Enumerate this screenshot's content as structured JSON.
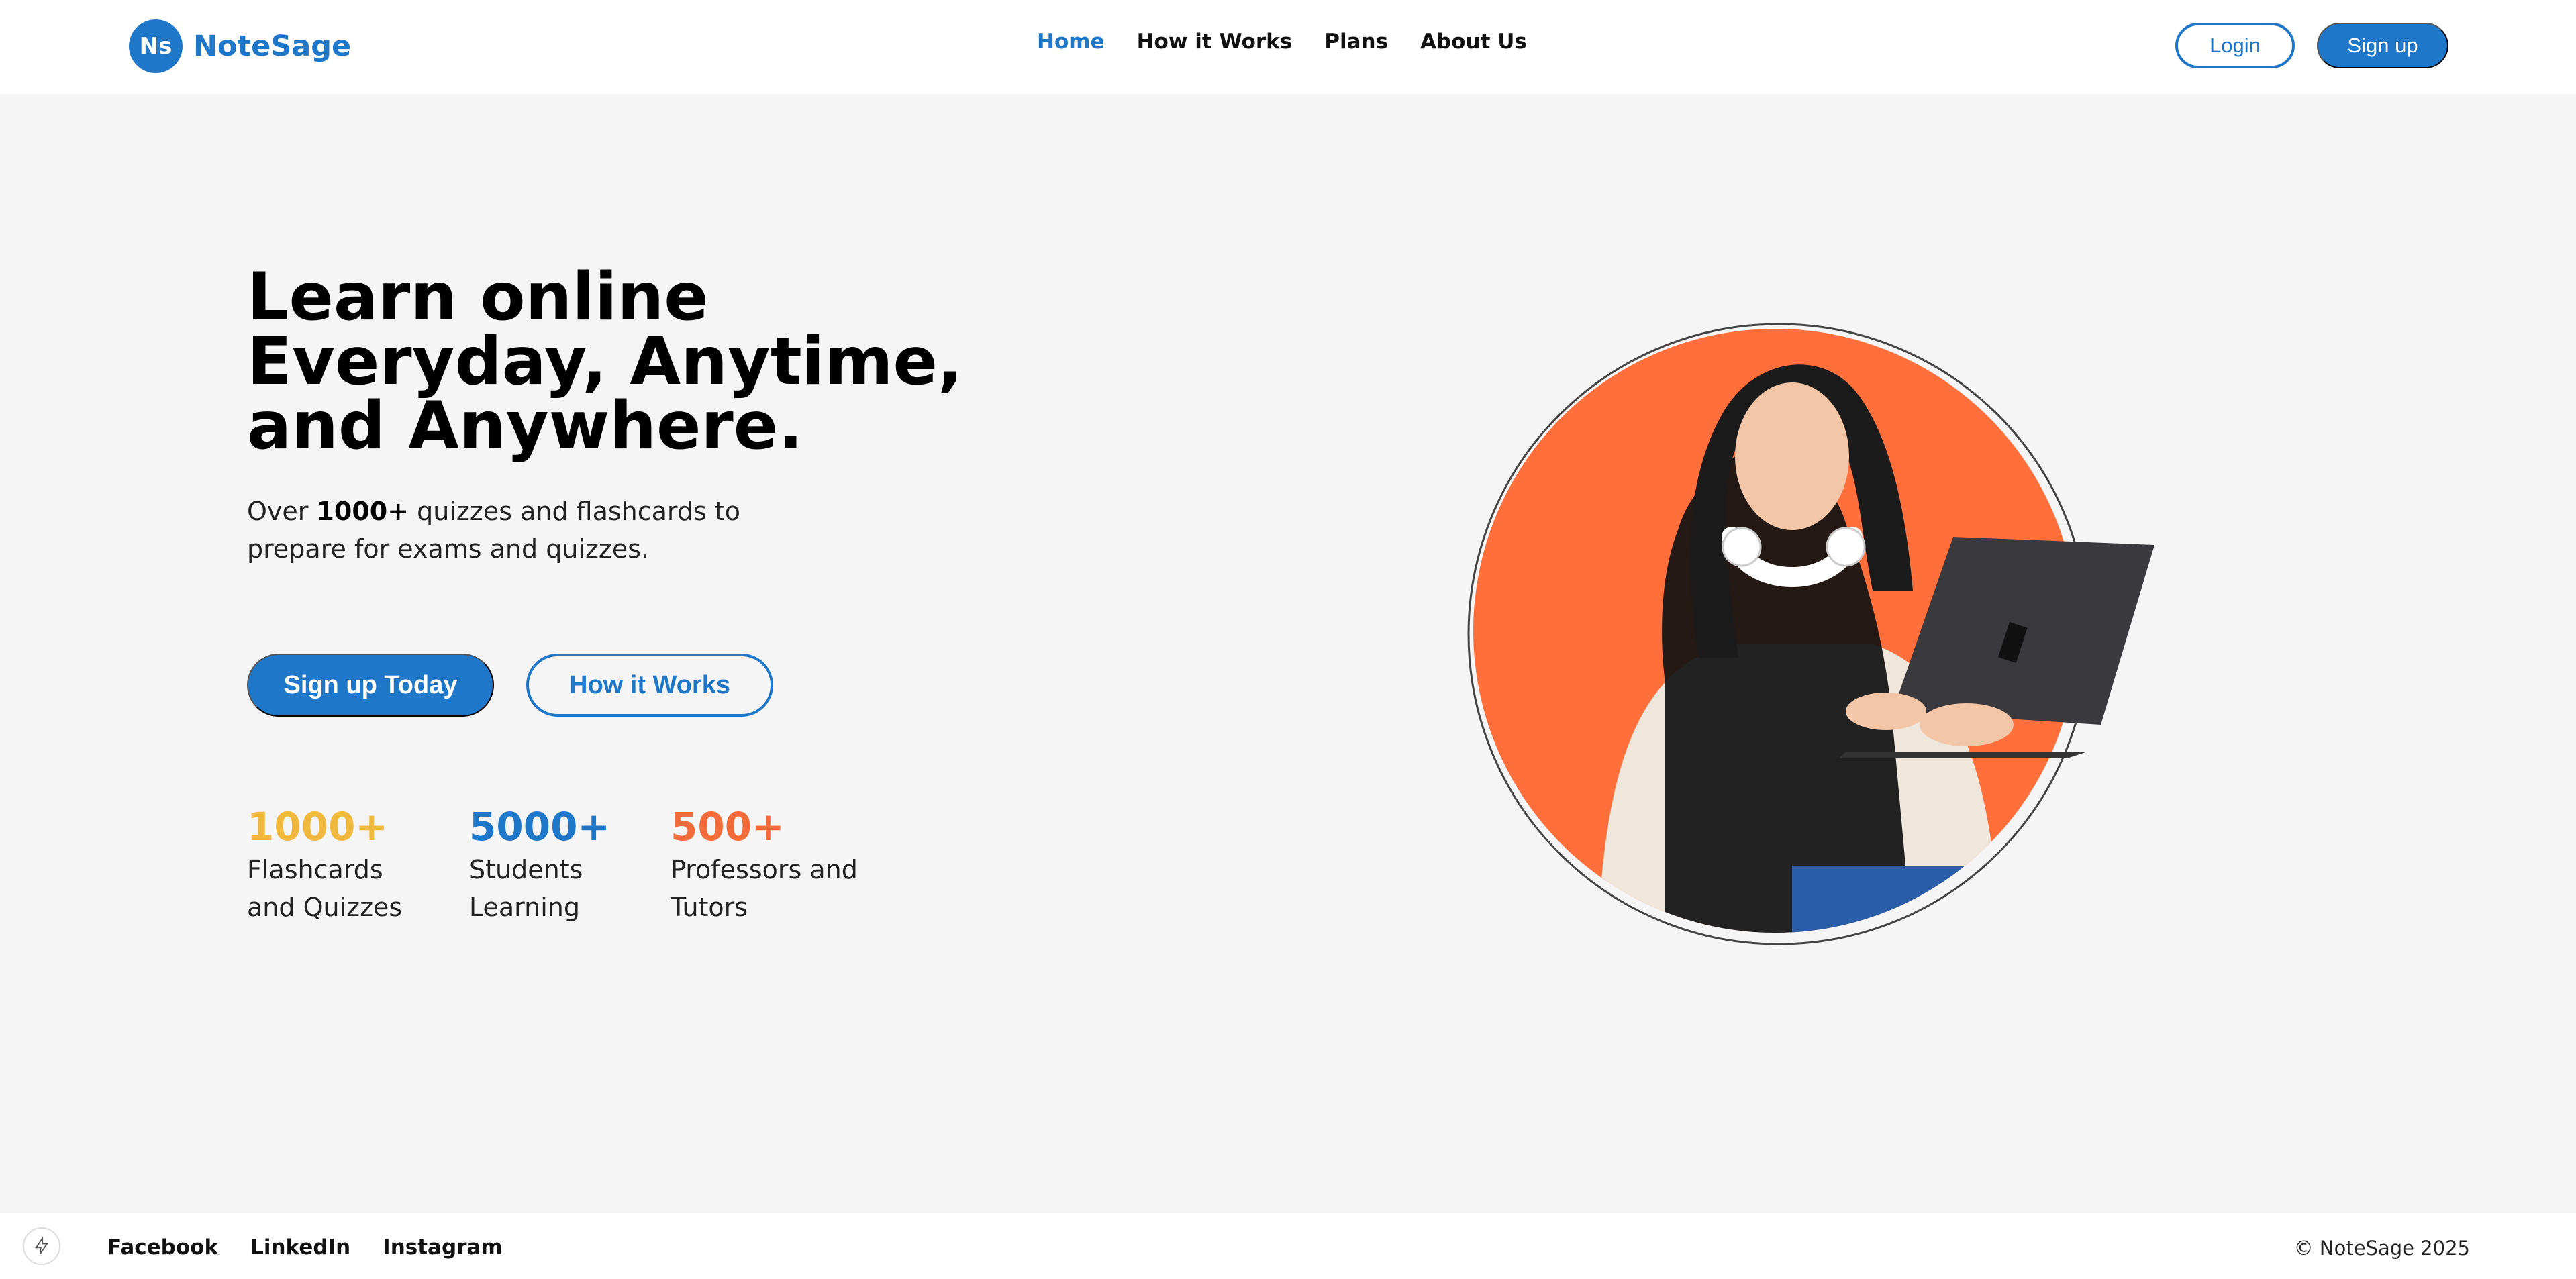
{
  "brand": {
    "badge": "Ns",
    "name": "NoteSage",
    "color": "#1f77c9"
  },
  "nav": {
    "items": [
      {
        "label": "Home",
        "active": true
      },
      {
        "label": "How it Works"
      },
      {
        "label": "Plans"
      },
      {
        "label": "About Us"
      }
    ]
  },
  "auth": {
    "login": "Login",
    "signup": "Sign up"
  },
  "hero": {
    "title_line1": "Learn online",
    "title_line2": "Everyday, Anytime,",
    "title_line3": "and Anywhere.",
    "subtitle_pre": "Over ",
    "subtitle_bold": "1000+",
    "subtitle_post": " quizzes and flashcards to prepare for exams and quizzes.",
    "cta_primary": "Sign up Today",
    "cta_secondary": "How it Works"
  },
  "stats": [
    {
      "number": "1000+",
      "label_line1": "Flashcards",
      "label_line2": "and Quizzes",
      "color": "#f0b93d"
    },
    {
      "number": "5000+",
      "label_line1": "Students",
      "label_line2": "Learning",
      "color": "#1f77c9"
    },
    {
      "number": "500+",
      "label_line1": "Professors and",
      "label_line2": "Tutors",
      "color": "#f26b3a"
    }
  ],
  "footer": {
    "links": [
      "Facebook",
      "LinkedIn",
      "Instagram"
    ],
    "copyright": "© NoteSage 2025"
  },
  "colors": {
    "accent_orange": "#ff6f3c",
    "background": "#f5f5f5"
  }
}
